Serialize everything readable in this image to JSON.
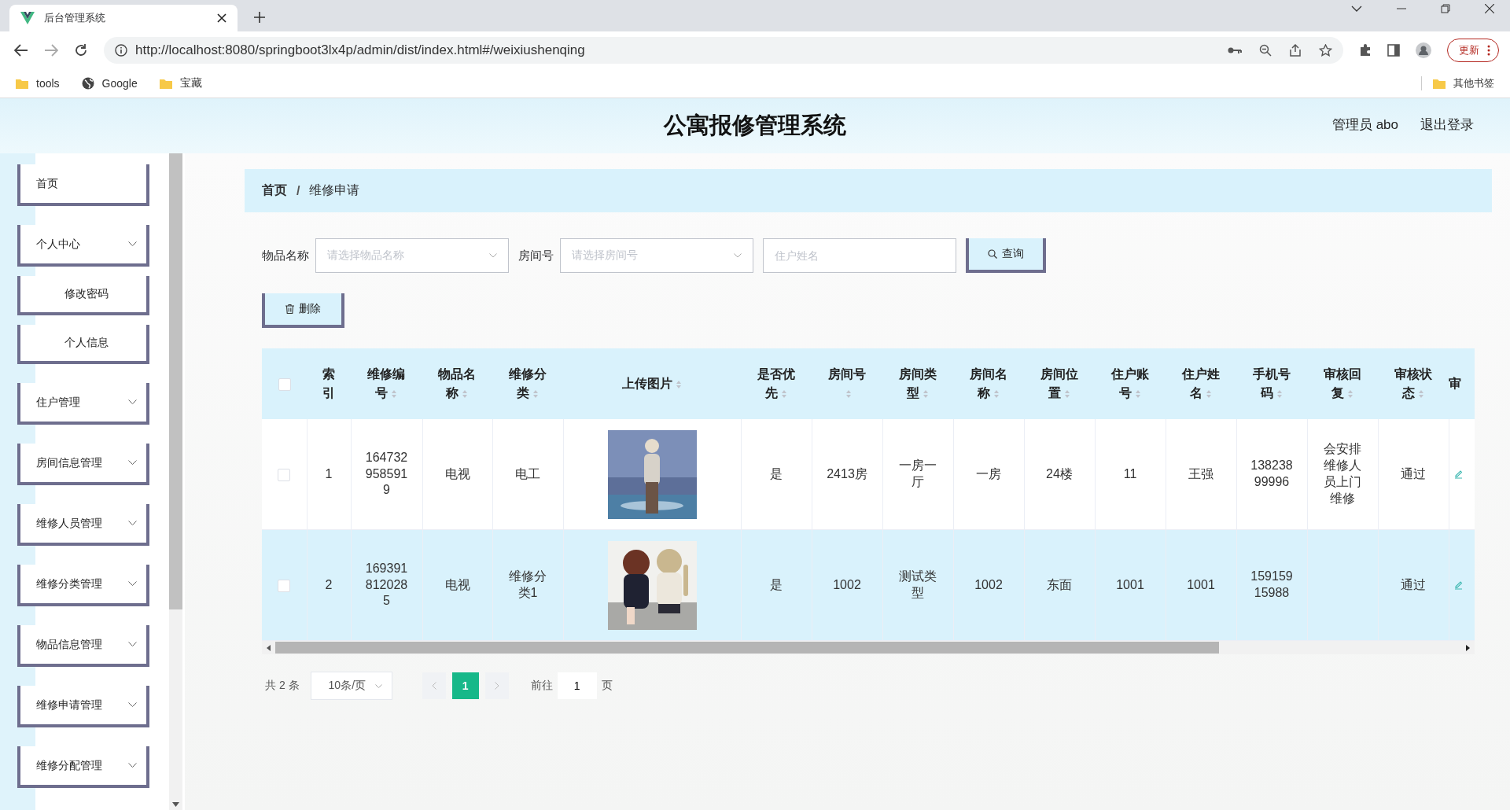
{
  "browser": {
    "tab_title": "后台管理系统",
    "url": "http://localhost:8080/springboot3lx4p/admin/dist/index.html#/weixiushenqing",
    "update_button": "更新",
    "bookmarks": [
      {
        "label": "tools",
        "kind": "folder"
      },
      {
        "label": "Google",
        "kind": "site"
      },
      {
        "label": "宝藏",
        "kind": "folder"
      }
    ],
    "other_bookmarks": "其他书签"
  },
  "header": {
    "title": "公寓报修管理系统",
    "user": "管理员 abo",
    "logout": "退出登录"
  },
  "sidebar": {
    "items": [
      {
        "label": "首页",
        "kind": "menu",
        "expandable": false
      },
      {
        "label": "个人中心",
        "kind": "menu",
        "expandable": true
      },
      {
        "label": "修改密码",
        "kind": "submenu",
        "expandable": false
      },
      {
        "label": "个人信息",
        "kind": "submenu",
        "expandable": false
      },
      {
        "label": "住户管理",
        "kind": "menu",
        "expandable": true
      },
      {
        "label": "房间信息管理",
        "kind": "menu",
        "expandable": true
      },
      {
        "label": "维修人员管理",
        "kind": "menu",
        "expandable": true
      },
      {
        "label": "维修分类管理",
        "kind": "menu",
        "expandable": true
      },
      {
        "label": "物品信息管理",
        "kind": "menu",
        "expandable": true
      },
      {
        "label": "维修申请管理",
        "kind": "menu",
        "expandable": true
      },
      {
        "label": "维修分配管理",
        "kind": "menu",
        "expandable": true
      }
    ]
  },
  "breadcrumb": {
    "items": [
      "首页",
      "维修申请"
    ],
    "separator": "/"
  },
  "search": {
    "fields": [
      {
        "label": "物品名称",
        "placeholder": "请选择物品名称",
        "kind": "select"
      },
      {
        "label": "房间号",
        "placeholder": "请选择房间号",
        "kind": "select"
      },
      {
        "placeholder": "住户姓名",
        "kind": "input"
      }
    ],
    "button": "查询"
  },
  "delete_button": "删除",
  "table": {
    "all_checked": false,
    "columns": [
      {
        "kind": "check"
      },
      {
        "label": "索引",
        "kind": "index"
      },
      {
        "label": "维修编号",
        "kind": "text"
      },
      {
        "label": "物品名称",
        "kind": "text"
      },
      {
        "label": "维修分类",
        "kind": "text"
      },
      {
        "label": "上传图片"
      },
      {
        "label": "是否优先",
        "kind": "text"
      },
      {
        "label": "房间号",
        "kind": "text"
      },
      {
        "label": "房间类型",
        "kind": "text"
      },
      {
        "label": "房间名称",
        "kind": "text"
      },
      {
        "label": "房间位置",
        "kind": "text"
      },
      {
        "label": "住户账号",
        "kind": "text"
      },
      {
        "label": "住户姓名",
        "kind": "text"
      },
      {
        "label": "手机号码",
        "kind": "text"
      },
      {
        "label": "审核回复",
        "kind": "text"
      },
      {
        "label": "审核状态",
        "kind": "text"
      },
      {
        "label": "审",
        "kind": "action"
      }
    ],
    "rows": [
      {
        "checked": false,
        "highlighted": false,
        "cells": [
          "",
          "1",
          "1647329585919",
          "电视",
          "电工",
          "",
          "是",
          "2413房",
          "一房一厅",
          "一房",
          "24楼",
          "11",
          "王强",
          "13823899996",
          "会安排维修人员上门维修",
          "通过",
          ""
        ]
      },
      {
        "checked": false,
        "highlighted": true,
        "cells": [
          "",
          "2",
          "1693918120285",
          "电视",
          "维修分类1",
          "",
          "是",
          "1002",
          "测试类型",
          "1002",
          "东面",
          "1001",
          "1001",
          "15915915988",
          "",
          "通过",
          ""
        ]
      }
    ]
  },
  "pagination": {
    "total": "共 2 条",
    "page_size": "10条/页",
    "pages": [
      {
        "label": "1",
        "selected": true
      }
    ],
    "goto_label": "前往",
    "goto_value": "1",
    "page_suffix": "页"
  }
}
